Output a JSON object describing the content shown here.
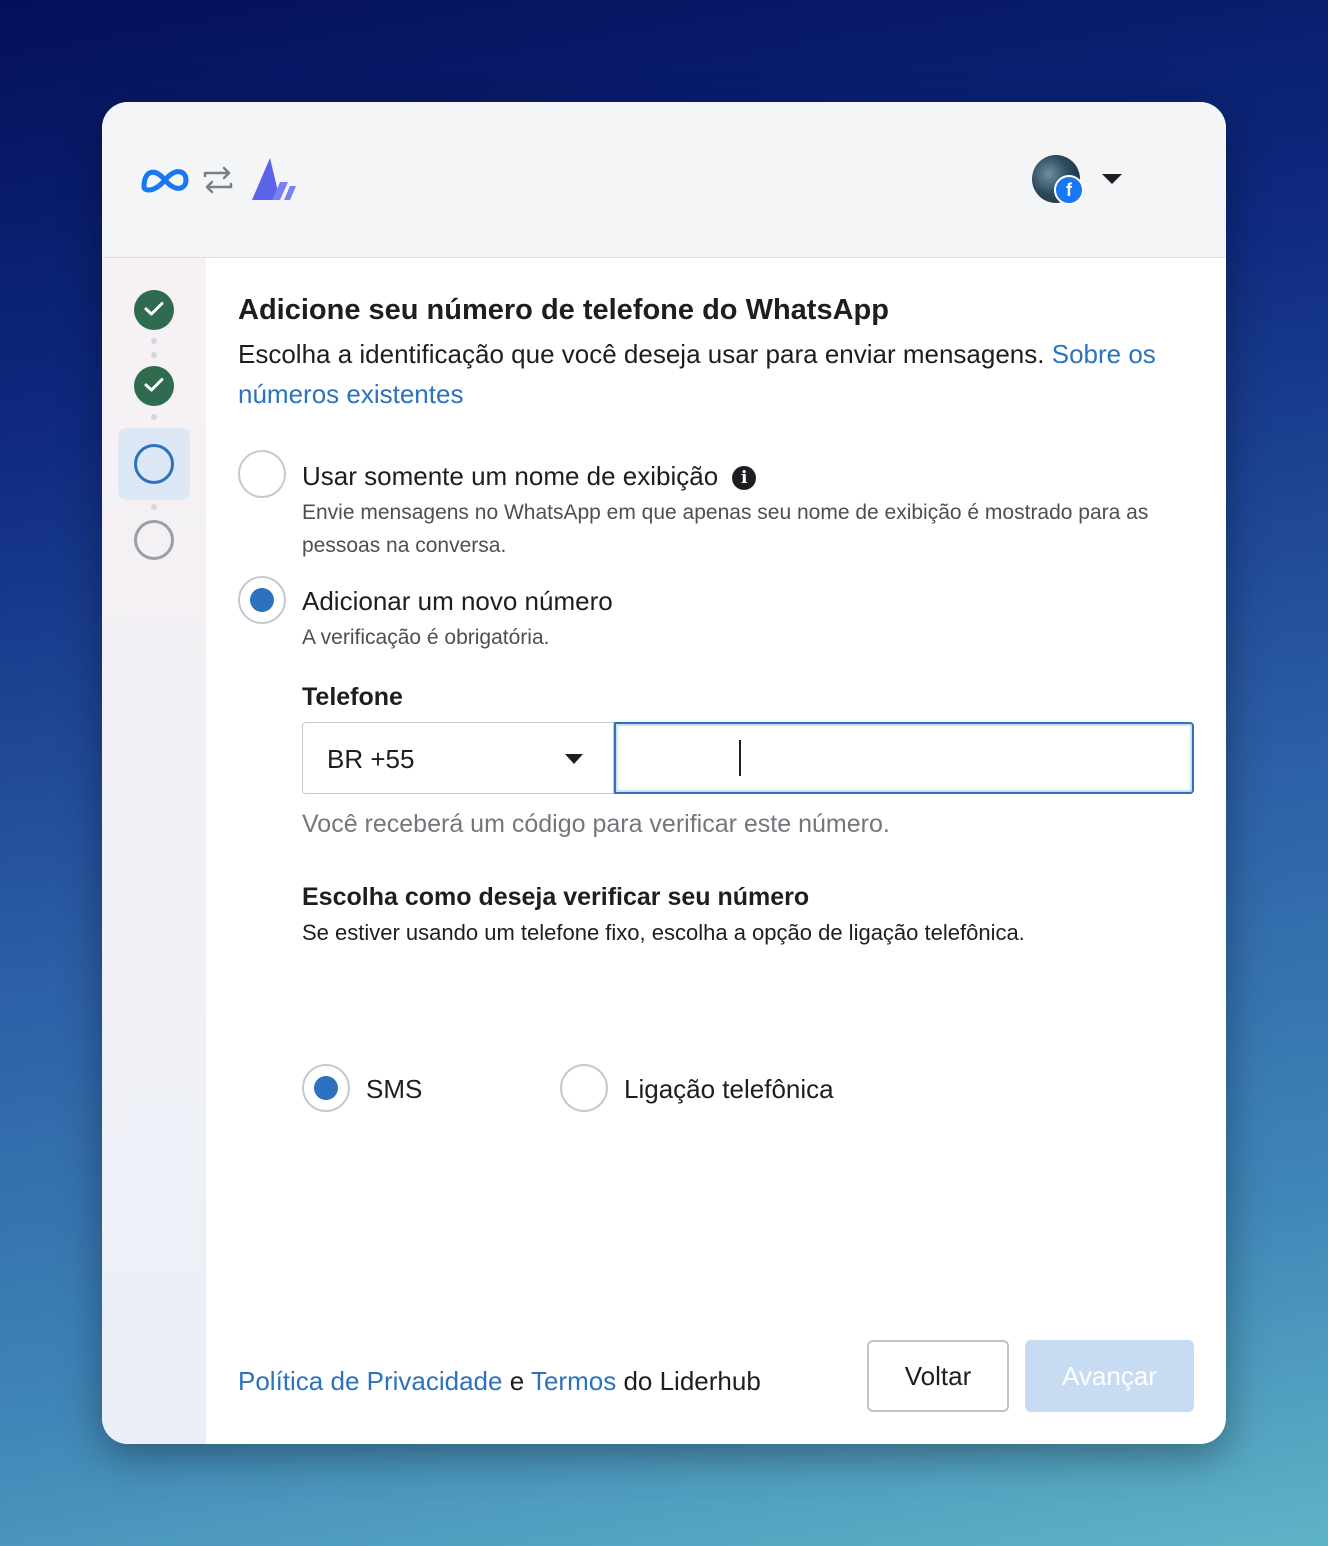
{
  "header": {
    "meta_logo_icon": "meta-infinity-logo",
    "swap_icon": "swap-arrows-icon",
    "app_logo_icon": "liderhub-logo",
    "account": {
      "badge": "f",
      "caret_icon": "caret-down-icon"
    }
  },
  "steps": [
    {
      "status": "done",
      "icon": "check-icon"
    },
    {
      "status": "done",
      "icon": "check-icon"
    },
    {
      "status": "current"
    },
    {
      "status": "todo"
    }
  ],
  "content": {
    "title": "Adicione seu número de telefone do WhatsApp",
    "subtitle": "Escolha a identificação que você deseja usar para enviar mensagens.",
    "subtitle_link": "Sobre os números existentes",
    "options": [
      {
        "label": "Usar somente um nome de exibição",
        "info_icon": "i",
        "description": "Envie mensagens no WhatsApp em que apenas seu nome de exibição é mostrado para as pessoas na conversa.",
        "selected": false
      },
      {
        "label": "Adicionar um novo número",
        "description": "A verificação é obrigatória.",
        "selected": true
      }
    ],
    "phone": {
      "label": "Telefone",
      "country_value": "BR +55",
      "number_value": "",
      "helper": "Você receberá um código para verificar este número."
    },
    "verify": {
      "title": "Escolha como deseja verificar seu número",
      "description": "Se estiver usando um telefone fixo, escolha a opção de ligação telefônica.",
      "methods": [
        {
          "label": "SMS",
          "selected": true
        },
        {
          "label": "Ligação telefônica",
          "selected": false
        }
      ]
    }
  },
  "footer": {
    "privacy_link": "Política de Privacidade",
    "and": "e",
    "terms_link": "Termos",
    "suffix": "do Liderhub",
    "back_button": "Voltar",
    "next_button": "Avançar"
  },
  "colors": {
    "accent": "#2d72bc",
    "step_done": "#2e6b4f",
    "disabled_button": "#c7dcf2"
  }
}
